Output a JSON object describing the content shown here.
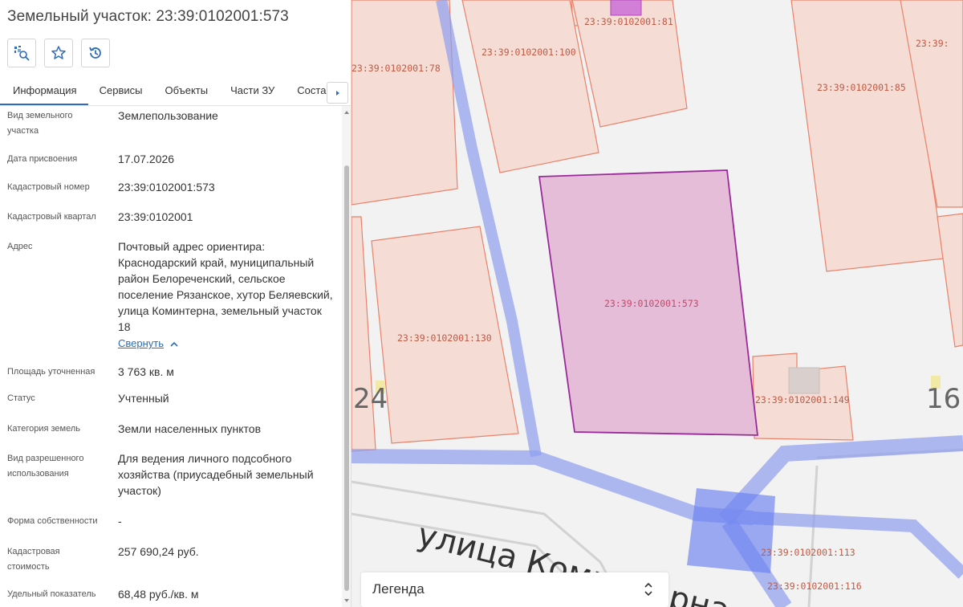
{
  "panel": {
    "title": "Земельный участок: 23:39:0102001:573",
    "actions": [
      {
        "icon": "search-on-map-icon"
      },
      {
        "icon": "star-icon"
      },
      {
        "icon": "history-icon"
      }
    ],
    "tabs": [
      {
        "label": "Информация",
        "active": true
      },
      {
        "label": "Сервисы"
      },
      {
        "label": "Объекты"
      },
      {
        "label": "Части ЗУ"
      },
      {
        "label": "Состав"
      }
    ],
    "fields": {
      "land_type": {
        "label": "Вид земельного участка",
        "value": "Землепользование"
      },
      "assign_date": {
        "label": "Дата присвоения",
        "value": "17.07.2026"
      },
      "cadastral_number": {
        "label": "Кадастровый номер",
        "value": "23:39:0102001:573"
      },
      "cadastral_quarter": {
        "label": "Кадастровый квартал",
        "value": "23:39:0102001"
      },
      "address": {
        "label": "Адрес",
        "value": "Почтовый адрес ориентира: Краснодарский край, муниципальный район Белореченский, сельское поселение Рязанское, хутор Беляевский, улица Коминтерна, земельный участок 18",
        "collapse_label": "Свернуть"
      },
      "area": {
        "label": "Площадь уточненная",
        "value": "3 763 кв. м"
      },
      "status": {
        "label": "Статус",
        "value": "Учтенный"
      },
      "land_category": {
        "label": "Категория земель",
        "value": "Земли населенных пунктов"
      },
      "permitted_use": {
        "label": "Вид разрешенного использования",
        "value": "Для ведения личного подсобного хозяйства (приусадебный земельный участок)"
      },
      "ownership": {
        "label": "Форма собственности",
        "value": "-"
      },
      "cadastral_value": {
        "label": "Кадастровая стоимость",
        "value": "257 690,24 руб."
      },
      "specific_value": {
        "label": "Удельный показатель",
        "value": "68,48 руб./кв. м"
      }
    }
  },
  "map": {
    "parcels": [
      {
        "label": "23:39:0102001:81"
      },
      {
        "label": "23:39:0102001:100"
      },
      {
        "label": "23:39:0102001:78"
      },
      {
        "label": "23:39:0102001:85"
      },
      {
        "label": "23:39:"
      },
      {
        "label": "23:39:0102001:573"
      },
      {
        "label": "23:39:0102001:130"
      },
      {
        "label": "23:39:0102001:149"
      },
      {
        "label": "23:39:0102001:113"
      },
      {
        "label": "23:39:0102001:116"
      }
    ],
    "street_label": "улица Коминтерна",
    "house_numbers": [
      "24",
      "16"
    ],
    "legend_label": "Легенда",
    "colors": {
      "parcel_fill": "#f5dcd5",
      "parcel_stroke": "#e8826a",
      "selected_fill": "#e6bdd8",
      "selected_stroke": "#9a2a9a",
      "road_overlay": "#8f9ef0"
    }
  }
}
